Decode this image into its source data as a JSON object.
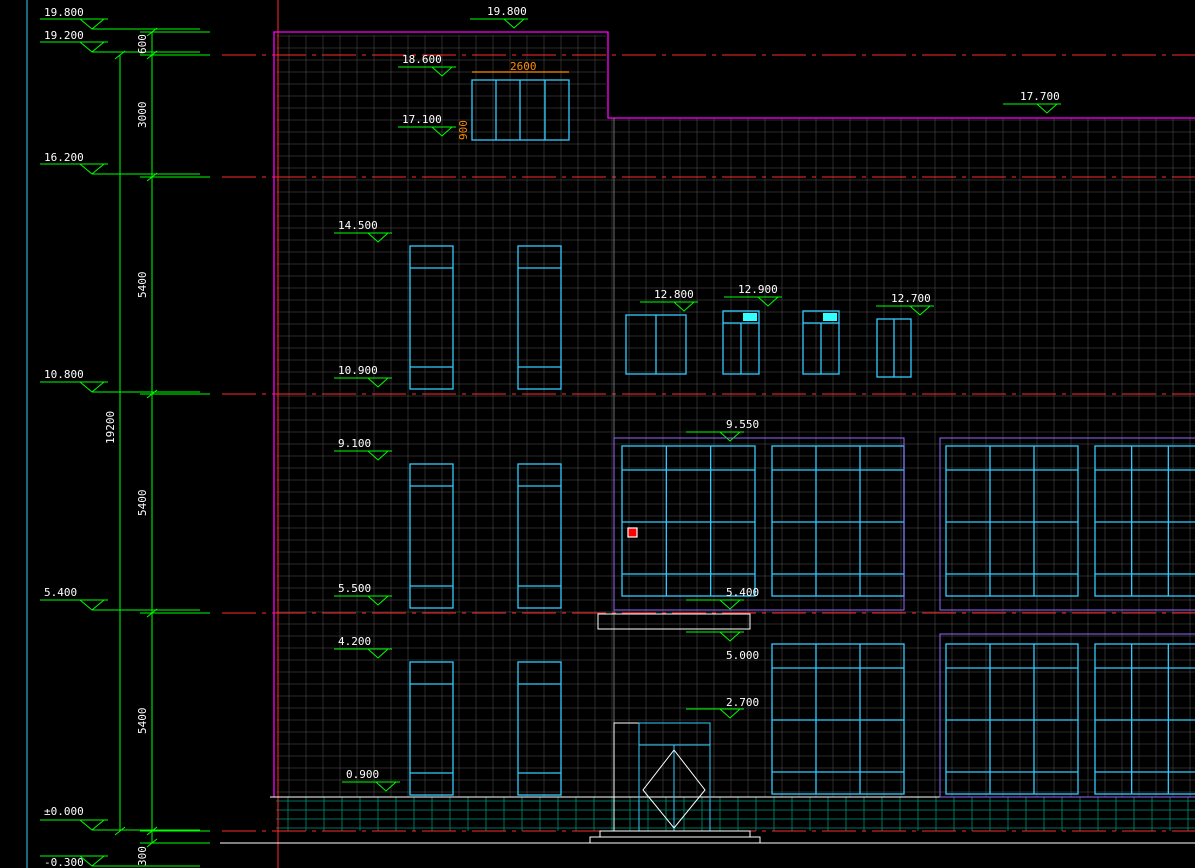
{
  "colors": {
    "background": "#000000",
    "dimension": "#00ff00",
    "label": "#ffffff",
    "outline": "#ff00ff",
    "window": "#33ccff",
    "axis": "#ff2a2a",
    "brick": "#b8b8b8",
    "base": "#00c8a0",
    "marker": "#ff0000"
  },
  "levels_left": [
    "19.800",
    "19.200",
    "16.200",
    "10.800",
    "5.400",
    "±0.000",
    "-0.300"
  ],
  "dimensions": {
    "d600": "600",
    "d3000": "3000",
    "d5400a": "5400",
    "d5400b": "5400",
    "d5400c": "5400",
    "total": "19200",
    "d300": "300"
  },
  "elevation_labels": {
    "roof_top": "19.800",
    "right_parapet": "17.700",
    "win_head_top": "18.600",
    "win_sill_top": "17.100",
    "win_width": "2600",
    "win_height": "900",
    "l3_head": "14.500",
    "l3_sill": "10.900",
    "l2_head": "9.100",
    "l2_sill": "5.500",
    "l1_head": "4.200",
    "l1_sill": "0.900",
    "small_win_1": "12.800",
    "small_win_2": "12.900",
    "small_win_3": "12.700",
    "curtain_top": "9.550",
    "canopy_top": "5.400",
    "canopy_bottom": "5.000",
    "door_head": "2.700"
  }
}
